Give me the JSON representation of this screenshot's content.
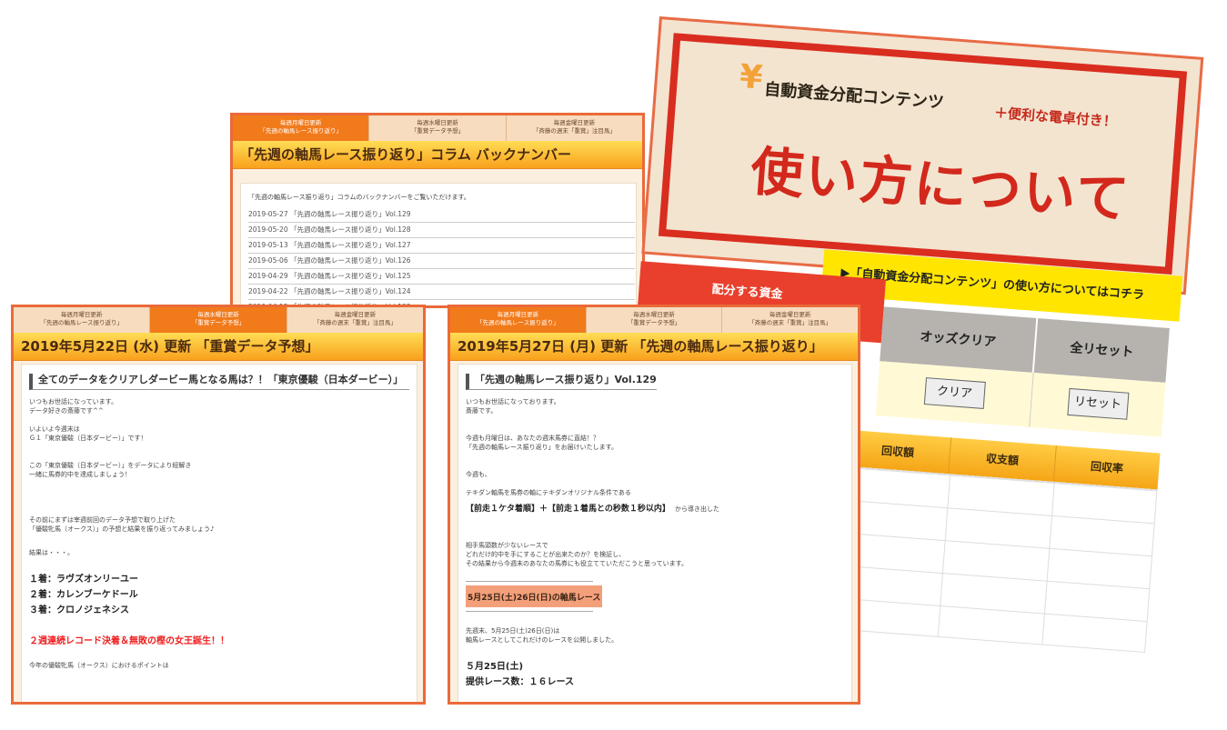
{
  "tabs": {
    "mon": [
      "毎週月曜日更新",
      "「先週の軸馬レース振り返り」"
    ],
    "wed": [
      "毎週水曜日更新",
      "「重賞データ予想」"
    ],
    "fri": [
      "毎週金曜日更新",
      "「斉藤の週末「重賞」注目馬」"
    ]
  },
  "panel_back": {
    "title": "「先週の軸馬レース振り返り」コラム バックナンバー",
    "intro": "「先週の軸馬レース振り返り」コラムのバックナンバーをご覧いただけます。",
    "rows": [
      "2019-05-27 「先週の軸馬レース振り返り」Vol.129",
      "2019-05-20 「先週の軸馬レース振り返り」Vol.128",
      "2019-05-13 「先週の軸馬レース振り返り」Vol.127",
      "2019-05-06 「先週の軸馬レース振り返り」Vol.126",
      "2019-04-29 「先週の軸馬レース振り返り」Vol.125",
      "2019-04-22 「先週の軸馬レース振り返り」Vol.124",
      "2019-04-15 「先週の軸馬レース振り返り」Vol.123"
    ]
  },
  "panel_left": {
    "title": "2019年5月22日 (水) 更新 「重賞データ予想」",
    "heading": "全てのデータをクリアしダービー馬となる馬は？！「東京優駿（日本ダービー）」",
    "p1": "いつもお世話になっています。",
    "p2": "データ好きの斎藤です^^",
    "p3": "いよいよ今週末は",
    "p4": "Ｇ１「東京優駿（日本ダービー）」です！",
    "p5": "この「東京優駿（日本ダービー）」をデータにより紐解き",
    "p6": "一緒に馬券的中を達成しましょう！",
    "p7": "その前にまずは宰週前回のデータ予想で取り上げた",
    "p8": "「優駿牝馬（オークス）」の予想と結果を振り返ってみましょう♪",
    "p9": "結果は・・・。",
    "r1": "１着：ラヴズオンリーユー",
    "r2": "２着：カレンブーケドール",
    "r3": "３着：クロノジェネシス",
    "red": "２週連続レコード決着＆無敗の樫の女王誕生！！",
    "p10": "今年の優駿牝馬（オークス）におけるポイントは"
  },
  "panel_mid": {
    "title": "2019年5月27日 (月) 更新 「先週の軸馬レース振り返り」",
    "heading": "「先週の軸馬レース振り返り」Vol.129",
    "p1": "いつもお世話になっております。",
    "p2": "斎藤です。",
    "p3": "今週も月曜日は、あなたの週末馬券に直結！？",
    "p4": "「先週の軸馬レース振り返り」をお届けいたします。",
    "p5": "今週も、",
    "p6": "テキダン軸馬を馬券の軸にテキダンオリジナル条件である",
    "cond": "【前走１ケタ着順】＋【前走１着馬との秒数１秒以内】",
    "cond_tail": "から導き出した",
    "p7": "相手馬頭数が少ないレースで",
    "p8": "どれだけ的中を手にすることが出来たのか？を検証し、",
    "p9": "その結果から今週末のあなたの馬券にも役立てていただこうと思っています。",
    "hl": "5月25日(土)26日(日)の軸馬レース",
    "p10": "先週末、5月25日(土)26日(日)は",
    "p11": "軸馬レースとしてこれだけのレースを公開しました。",
    "d1": "５月25日(土)",
    "d2": "提供レース数：１６レース"
  },
  "card": {
    "yen": "¥",
    "sub": "自動資金分配コンテンツ",
    "plus": "＋便利な電卓付き！",
    "big": "使い方について",
    "link": "▶「自動資金分配コンテンツ」の使い方についてはコチラ",
    "tab_red": "配分する資金",
    "col_odds": "オッズクリア",
    "col_reset": "全リセット",
    "btn_clear": "クリア",
    "btn_reset": "リセット",
    "h_kaishu": "回収額",
    "h_shushi": "収支額",
    "h_rate": "回収率"
  }
}
